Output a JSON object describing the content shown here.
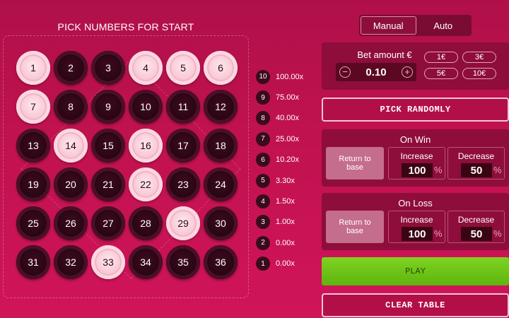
{
  "board": {
    "title": "PICK NUMBERS FOR START",
    "balls": [
      {
        "n": "1",
        "selected": true
      },
      {
        "n": "2",
        "selected": false
      },
      {
        "n": "3",
        "selected": false
      },
      {
        "n": "4",
        "selected": true
      },
      {
        "n": "5",
        "selected": true
      },
      {
        "n": "6",
        "selected": true
      },
      {
        "n": "7",
        "selected": true
      },
      {
        "n": "8",
        "selected": false
      },
      {
        "n": "9",
        "selected": false
      },
      {
        "n": "10",
        "selected": false
      },
      {
        "n": "11",
        "selected": false
      },
      {
        "n": "12",
        "selected": false
      },
      {
        "n": "13",
        "selected": false
      },
      {
        "n": "14",
        "selected": true
      },
      {
        "n": "15",
        "selected": false
      },
      {
        "n": "16",
        "selected": true
      },
      {
        "n": "17",
        "selected": false
      },
      {
        "n": "18",
        "selected": false
      },
      {
        "n": "19",
        "selected": false
      },
      {
        "n": "20",
        "selected": false
      },
      {
        "n": "21",
        "selected": false
      },
      {
        "n": "22",
        "selected": true
      },
      {
        "n": "23",
        "selected": false
      },
      {
        "n": "24",
        "selected": false
      },
      {
        "n": "25",
        "selected": false
      },
      {
        "n": "26",
        "selected": false
      },
      {
        "n": "27",
        "selected": false
      },
      {
        "n": "28",
        "selected": false
      },
      {
        "n": "29",
        "selected": true
      },
      {
        "n": "30",
        "selected": false
      },
      {
        "n": "31",
        "selected": false
      },
      {
        "n": "32",
        "selected": false
      },
      {
        "n": "33",
        "selected": true
      },
      {
        "n": "34",
        "selected": false
      },
      {
        "n": "35",
        "selected": false
      },
      {
        "n": "36",
        "selected": false
      }
    ]
  },
  "payouts": [
    {
      "hits": "10",
      "multiplier": "100.00x"
    },
    {
      "hits": "9",
      "multiplier": "75.00x"
    },
    {
      "hits": "8",
      "multiplier": "40.00x"
    },
    {
      "hits": "7",
      "multiplier": "25.00x"
    },
    {
      "hits": "6",
      "multiplier": "10.20x"
    },
    {
      "hits": "5",
      "multiplier": "3.30x"
    },
    {
      "hits": "4",
      "multiplier": "1.50x"
    },
    {
      "hits": "3",
      "multiplier": "1.00x"
    },
    {
      "hits": "2",
      "multiplier": "0.00x"
    },
    {
      "hits": "1",
      "multiplier": "0.00x"
    }
  ],
  "mode": {
    "manual": "Manual",
    "auto": "Auto",
    "active": "Manual"
  },
  "bet": {
    "label": "Bet amount €",
    "value": "0.10",
    "minus": "−",
    "plus": "+",
    "chips": [
      "1€",
      "3€",
      "5€",
      "10€"
    ]
  },
  "pick_randomly": "PICK RANDOMLY",
  "on_win": {
    "title": "On Win",
    "return_line1": "Return to",
    "return_line2": "base",
    "increase_label": "Increase",
    "increase_value": "100",
    "decrease_label": "Decrease",
    "decrease_value": "50",
    "pct": "%"
  },
  "on_loss": {
    "title": "On Loss",
    "return_line1": "Return to",
    "return_line2": "base",
    "increase_label": "Increase",
    "increase_value": "100",
    "decrease_label": "Decrease",
    "decrease_value": "50",
    "pct": "%"
  },
  "play": "PLAY",
  "clear_table": "CLEAR TABLE",
  "colors": {
    "background": "#c1124f",
    "selected_ball": "#f7c3d1",
    "unselected_ball": "#2a0614",
    "play": "#6cc218"
  }
}
